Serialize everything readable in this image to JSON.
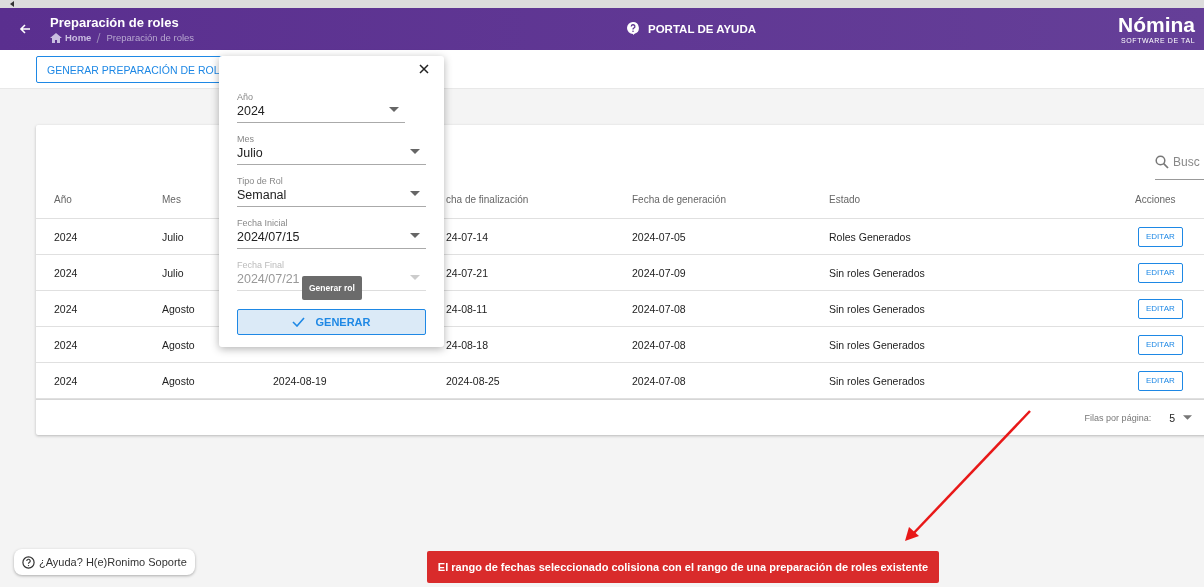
{
  "header": {
    "title": "Preparación de roles",
    "breadcrumb": {
      "home": "Home",
      "current": "Preparación de roles"
    },
    "help_portal": "PORTAL DE AYUDA",
    "logo": {
      "name": "Nómina",
      "tagline": "SOFTWARE DE TAL"
    }
  },
  "toolbar": {
    "button": "GENERAR PREPARACIÓN DE ROL"
  },
  "table": {
    "search": {
      "placeholder": "Busc"
    },
    "columns": {
      "year": "Año",
      "month": "Mes",
      "end": "cha de finalización",
      "generated": "Fecha de generación",
      "status": "Estado",
      "action": "Acciones"
    },
    "rows": [
      {
        "year": "2024",
        "month": "Julio",
        "end": "24-07-14",
        "generated": "2024-07-05",
        "status": "Roles Generados",
        "action": "EDITAR"
      },
      {
        "year": "2024",
        "month": "Julio",
        "end": "24-07-21",
        "generated": "2024-07-09",
        "status": "Sin roles Generados",
        "action": "EDITAR"
      },
      {
        "year": "2024",
        "month": "Agosto",
        "end": "24-08-11",
        "generated": "2024-07-08",
        "status": "Sin roles Generados",
        "action": "EDITAR"
      },
      {
        "year": "2024",
        "month": "Agosto",
        "end": "24-08-18",
        "generated": "2024-07-08",
        "status": "Sin roles Generados",
        "action": "EDITAR"
      },
      {
        "year": "2024",
        "month": "Agosto",
        "column_3": "2024-08-19",
        "end": "2024-08-25",
        "generated": "2024-07-08",
        "status": "Sin roles Generados",
        "action": "EDITAR"
      }
    ],
    "footer": {
      "rows_label": "Filas por página:",
      "rows_value": "5"
    }
  },
  "popup": {
    "fields": [
      {
        "label": "Año",
        "value": "2024",
        "disabled": false,
        "kind": "short"
      },
      {
        "label": "Mes",
        "value": "Julio",
        "disabled": false,
        "kind": "full"
      },
      {
        "label": "Tipo de Rol",
        "value": "Semanal",
        "disabled": false,
        "kind": "full"
      },
      {
        "label": "Fecha Inicial",
        "value": "2024/07/15",
        "disabled": false,
        "kind": "full"
      },
      {
        "label": "Fecha Final",
        "value": "2024/07/21",
        "disabled": true,
        "kind": "full"
      }
    ],
    "tooltip": "Generar rol",
    "button": "GENERAR"
  },
  "help_button": "¿Ayuda? H(e)Ronimo Soporte",
  "toast": "El rango de fechas seleccionado colisiona con el rango de una preparación de roles existente"
}
